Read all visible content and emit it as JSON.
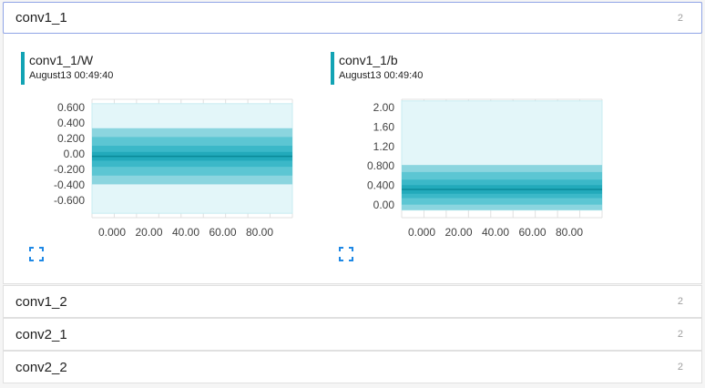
{
  "groups": [
    {
      "name": "conv1_1",
      "count": "2"
    },
    {
      "name": "conv1_2",
      "count": "2"
    },
    {
      "name": "conv2_1",
      "count": "2"
    },
    {
      "name": "conv2_2",
      "count": "2"
    }
  ],
  "colors": {
    "accent": "#12a3b4",
    "band_light": "#e1f5f8",
    "band_mid": "#7fd3df",
    "band_dark": "#26b5c6",
    "median": "#0a8a99"
  },
  "icons": {
    "expand": "fullscreen-expand-icon"
  },
  "chart_data": [
    {
      "type": "area",
      "title": "conv1_1/W",
      "subtitle": "August13 00:49:40",
      "x_ticks": [
        "0.000",
        "20.00",
        "40.00",
        "60.00",
        "80.00"
      ],
      "y_ticks": [
        "0.600",
        "0.400",
        "0.200",
        "0.00",
        "-0.200",
        "-0.400",
        "-0.600"
      ],
      "xlim": [
        0,
        90
      ],
      "ylim": [
        -0.7,
        0.65
      ],
      "x": [
        0,
        90
      ],
      "bands": [
        {
          "low": -0.65,
          "high": 0.6
        },
        {
          "low": -0.32,
          "high": 0.32
        },
        {
          "low": -0.22,
          "high": 0.22
        },
        {
          "low": -0.12,
          "high": 0.12
        },
        {
          "low": -0.05,
          "high": 0.05
        }
      ],
      "median": 0.0
    },
    {
      "type": "area",
      "title": "conv1_1/b",
      "subtitle": "August13 00:49:40",
      "x_ticks": [
        "0.000",
        "20.00",
        "40.00",
        "60.00",
        "80.00"
      ],
      "y_ticks": [
        "2.00",
        "1.60",
        "1.20",
        "0.800",
        "0.400",
        "0.00"
      ],
      "xlim": [
        0,
        90
      ],
      "ylim": [
        -0.1,
        2.08
      ],
      "x": [
        0,
        90
      ],
      "bands": [
        {
          "low": 0.04,
          "high": 2.05
        },
        {
          "low": 0.04,
          "high": 0.87
        },
        {
          "low": 0.14,
          "high": 0.74
        },
        {
          "low": 0.26,
          "high": 0.6
        },
        {
          "low": 0.34,
          "high": 0.5
        }
      ],
      "median": 0.42
    }
  ]
}
